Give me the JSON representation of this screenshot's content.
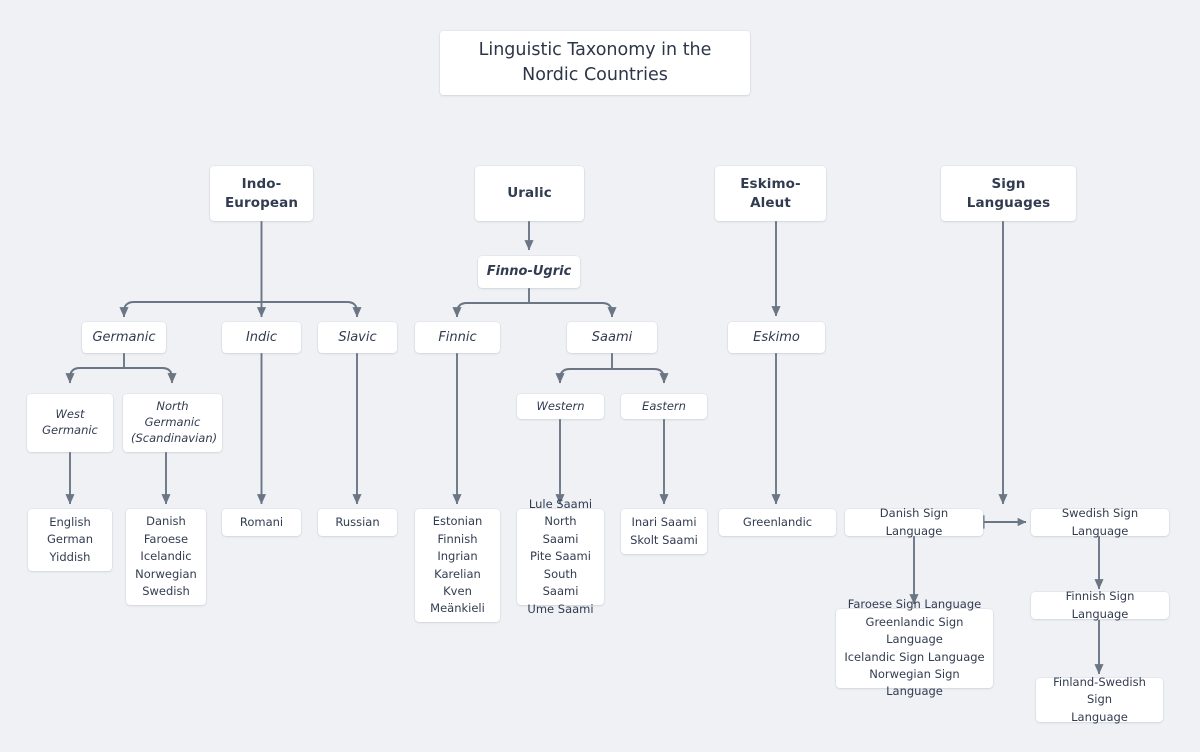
{
  "page": {
    "title": "Linguistic Taxonomy in the\nNordic Countries",
    "background_color": "#f0f1f5",
    "node_fill": "#ffffff",
    "text_color": "#323c51",
    "edge_color": "#6b7685"
  },
  "chart_data": {
    "type": "diagram",
    "title": "Linguistic Taxonomy in the Nordic Countries",
    "orientation": "top-down tree",
    "levels": [
      "family",
      "subfamily",
      "branch",
      "sub-branch",
      "languages"
    ],
    "nodes": [
      {
        "id": "indo_european",
        "label": "Indo-\nEuropean",
        "level": "family"
      },
      {
        "id": "uralic",
        "label": "Uralic",
        "level": "family"
      },
      {
        "id": "eskimo_aleut",
        "label": "Eskimo-Aleut",
        "level": "family"
      },
      {
        "id": "sign_languages",
        "label": "Sign Languages",
        "level": "family"
      },
      {
        "id": "finno_ugric",
        "label": "Finno-Ugric",
        "level": "subfamily"
      },
      {
        "id": "germanic",
        "label": "Germanic",
        "level": "branch"
      },
      {
        "id": "indic",
        "label": "Indic",
        "level": "branch"
      },
      {
        "id": "slavic",
        "label": "Slavic",
        "level": "branch"
      },
      {
        "id": "finnic",
        "label": "Finnic",
        "level": "branch"
      },
      {
        "id": "saami",
        "label": "Saami",
        "level": "branch"
      },
      {
        "id": "eskimo",
        "label": "Eskimo",
        "level": "branch"
      },
      {
        "id": "west_germanic",
        "label": "West\nGermanic",
        "level": "sub-branch"
      },
      {
        "id": "north_germanic",
        "label": "North Germanic\n(Scandinavian)",
        "level": "sub-branch"
      },
      {
        "id": "western_saami",
        "label": "Western",
        "level": "sub-branch"
      },
      {
        "id": "eastern_saami",
        "label": "Eastern",
        "level": "sub-branch"
      },
      {
        "id": "west_germanic_langs",
        "label": "English\nGerman\nYiddish",
        "level": "languages"
      },
      {
        "id": "north_germanic_langs",
        "label": "Danish\nFaroese\nIcelandic\nNorwegian\nSwedish",
        "level": "languages"
      },
      {
        "id": "indic_langs",
        "label": "Romani",
        "level": "languages"
      },
      {
        "id": "slavic_langs",
        "label": "Russian",
        "level": "languages"
      },
      {
        "id": "finnic_langs",
        "label": "Estonian\nFinnish\nIngrian\nKarelian\nKven\nMeänkieli",
        "level": "languages"
      },
      {
        "id": "western_saami_langs",
        "label": "Lule Saami\nNorth Saami\nPite Saami\nSouth Saami\nUme Saami",
        "level": "languages"
      },
      {
        "id": "eastern_saami_langs",
        "label": "Inari Saami\nSkolt Saami",
        "level": "languages"
      },
      {
        "id": "eskimo_langs",
        "label": "Greenlandic",
        "level": "languages"
      },
      {
        "id": "danish_sign",
        "label": "Danish Sign Language",
        "level": "languages"
      },
      {
        "id": "swedish_sign",
        "label": "Swedish Sign Language",
        "level": "languages"
      },
      {
        "id": "danish_sign_derived",
        "label": "Faroese Sign Language\nGreenlandic Sign Language\nIcelandic Sign Language\nNorwegian Sign Language",
        "level": "languages"
      },
      {
        "id": "finnish_sign",
        "label": "Finnish Sign Language",
        "level": "languages"
      },
      {
        "id": "finland_swedish_sign",
        "label": "Finland-Swedish Sign\nLanguage",
        "level": "languages"
      }
    ],
    "edges": [
      {
        "from": "indo_european",
        "to": "germanic",
        "style": "elbow-arrow"
      },
      {
        "from": "indo_european",
        "to": "indic",
        "style": "elbow-arrow"
      },
      {
        "from": "indo_european",
        "to": "slavic",
        "style": "elbow-arrow"
      },
      {
        "from": "uralic",
        "to": "finno_ugric",
        "style": "arrow"
      },
      {
        "from": "finno_ugric",
        "to": "finnic",
        "style": "elbow-arrow"
      },
      {
        "from": "finno_ugric",
        "to": "saami",
        "style": "elbow-arrow"
      },
      {
        "from": "eskimo_aleut",
        "to": "eskimo",
        "style": "arrow"
      },
      {
        "from": "germanic",
        "to": "west_germanic",
        "style": "elbow-arrow"
      },
      {
        "from": "germanic",
        "to": "north_germanic",
        "style": "elbow-arrow"
      },
      {
        "from": "saami",
        "to": "western_saami",
        "style": "elbow-arrow"
      },
      {
        "from": "saami",
        "to": "eastern_saami",
        "style": "elbow-arrow"
      },
      {
        "from": "west_germanic",
        "to": "west_germanic_langs",
        "style": "arrow"
      },
      {
        "from": "north_germanic",
        "to": "north_germanic_langs",
        "style": "arrow"
      },
      {
        "from": "indic",
        "to": "indic_langs",
        "style": "arrow"
      },
      {
        "from": "slavic",
        "to": "slavic_langs",
        "style": "arrow"
      },
      {
        "from": "finnic",
        "to": "finnic_langs",
        "style": "arrow"
      },
      {
        "from": "western_saami",
        "to": "western_saami_langs",
        "style": "arrow"
      },
      {
        "from": "eastern_saami",
        "to": "eastern_saami_langs",
        "style": "arrow"
      },
      {
        "from": "eskimo",
        "to": "eskimo_langs",
        "style": "arrow"
      },
      {
        "from": "sign_languages",
        "to": "swedish_sign",
        "style": "arrow"
      },
      {
        "from": "danish_sign",
        "to": "swedish_sign",
        "style": "double-arrow-horizontal"
      },
      {
        "from": "danish_sign",
        "to": "danish_sign_derived",
        "style": "arrow"
      },
      {
        "from": "swedish_sign",
        "to": "finnish_sign",
        "style": "arrow"
      },
      {
        "from": "finnish_sign",
        "to": "finland_swedish_sign",
        "style": "arrow"
      }
    ]
  }
}
